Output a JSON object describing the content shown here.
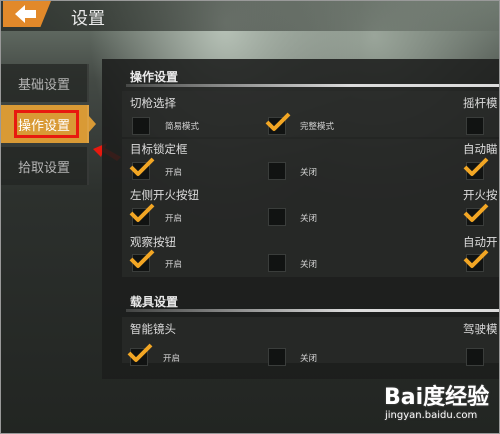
{
  "header": {
    "title": "设置"
  },
  "sidebar": {
    "items": [
      {
        "label": "基础设置",
        "active": false
      },
      {
        "label": "操作设置",
        "active": true
      },
      {
        "label": "拾取设置",
        "active": false
      }
    ]
  },
  "sections": {
    "operation": {
      "header": "操作设置",
      "rows": [
        {
          "label": "切枪选择",
          "options": [
            {
              "label": "简易模式",
              "checked": false
            },
            {
              "label": "完整模式",
              "checked": true
            }
          ],
          "right_label": "摇杆模",
          "right_checked": false
        },
        {
          "label": "目标锁定框",
          "options": [
            {
              "label": "开启",
              "checked": true
            },
            {
              "label": "关闭",
              "checked": false
            }
          ],
          "right_label": "自动瞄",
          "right_checked": true
        },
        {
          "label": "左侧开火按钮",
          "options": [
            {
              "label": "开启",
              "checked": true
            },
            {
              "label": "关闭",
              "checked": false
            }
          ],
          "right_label": "开火按",
          "right_checked": true
        },
        {
          "label": "观察按钮",
          "options": [
            {
              "label": "开启",
              "checked": true
            },
            {
              "label": "关闭",
              "checked": false
            }
          ],
          "right_label": "自动开",
          "right_checked": true
        }
      ]
    },
    "vehicle": {
      "header": "载具设置",
      "rows": [
        {
          "label": "智能镜头",
          "options": [
            {
              "label": "开启",
              "checked": true
            },
            {
              "label": "关闭",
              "checked": false
            }
          ],
          "right_label": "驾驶模",
          "right_checked": false
        }
      ]
    }
  },
  "watermark": {
    "brand": "Bai度经验",
    "url": "jingyan.baidu.com"
  },
  "colors": {
    "accent": "#d99a35",
    "back_button": "#e2892a",
    "highlight": "#e8190f",
    "check": "#f2a624"
  }
}
